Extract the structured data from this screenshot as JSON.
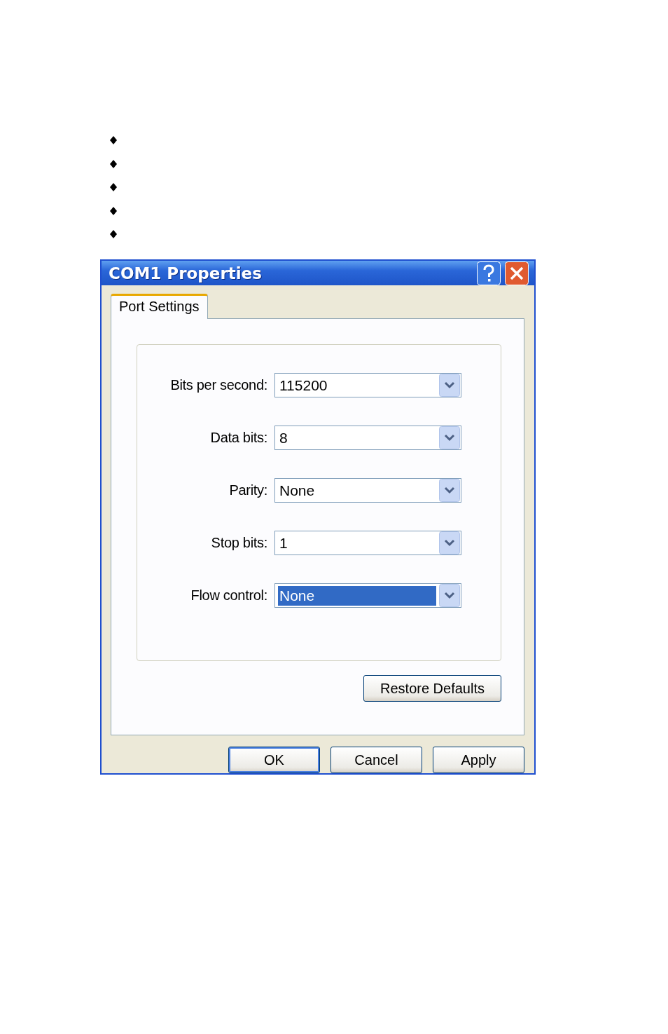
{
  "bullets": [
    {
      "kind": "diamond"
    },
    {
      "kind": "diamond"
    },
    {
      "kind": "diamond"
    },
    {
      "kind": "diamond"
    },
    {
      "kind": "diamond"
    }
  ],
  "window": {
    "title": "COM1 Properties"
  },
  "tabs": [
    {
      "label": "Port Settings",
      "selected": true
    }
  ],
  "fields": [
    {
      "label": "Bits per second:",
      "value": "115200",
      "focused": false
    },
    {
      "label": "Data bits:",
      "value": "8",
      "focused": false
    },
    {
      "label": "Parity:",
      "value": "None",
      "focused": false
    },
    {
      "label": "Stop bits:",
      "value": "1",
      "focused": false
    },
    {
      "label": "Flow control:",
      "value": "None",
      "focused": true
    }
  ],
  "restore_button": "Restore Defaults",
  "buttons": [
    {
      "label": "OK",
      "default": true
    },
    {
      "label": "Cancel",
      "default": false
    },
    {
      "label": "Apply",
      "default": false
    }
  ]
}
